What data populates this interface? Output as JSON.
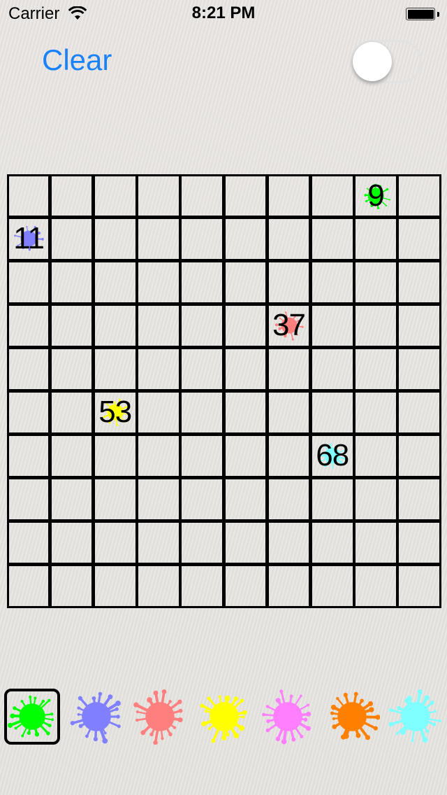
{
  "status_bar": {
    "carrier": "Carrier",
    "time": "8:21 PM",
    "wifi_icon": "wifi-icon",
    "battery_icon": "battery-full-icon",
    "battery_level": 1.0
  },
  "toolbar": {
    "clear_label": "Clear",
    "toggle_on": false
  },
  "board": {
    "rows": 10,
    "cols": 10,
    "marked_cells": [
      {
        "number": "9",
        "row": 0,
        "col": 8,
        "color": "#00ff00"
      },
      {
        "number": "11",
        "row": 1,
        "col": 0,
        "color": "#7f7fff"
      },
      {
        "number": "37",
        "row": 3,
        "col": 6,
        "color": "#ff7f7f"
      },
      {
        "number": "53",
        "row": 5,
        "col": 2,
        "color": "#ffff00"
      },
      {
        "number": "68",
        "row": 6,
        "col": 7,
        "color": "#7fffff"
      }
    ]
  },
  "palette": {
    "selected_index": 0,
    "colors": [
      {
        "name": "green",
        "hex": "#00ff00"
      },
      {
        "name": "blue",
        "hex": "#7f7fff"
      },
      {
        "name": "red",
        "hex": "#ff7f7f"
      },
      {
        "name": "yellow",
        "hex": "#ffff00"
      },
      {
        "name": "magenta",
        "hex": "#ff7fff"
      },
      {
        "name": "orange",
        "hex": "#ff7f00"
      },
      {
        "name": "cyan",
        "hex": "#7fffff"
      }
    ]
  }
}
